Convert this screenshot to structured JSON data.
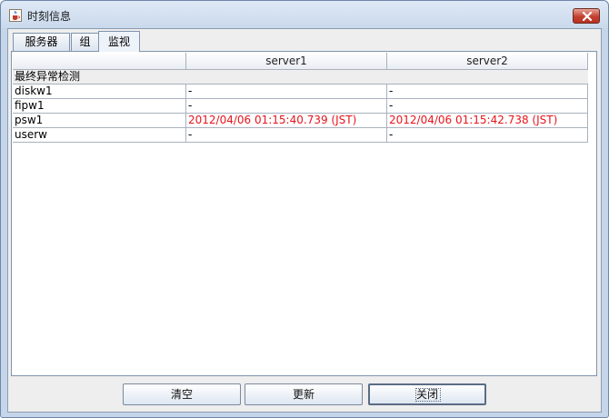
{
  "window": {
    "title": "时刻信息",
    "icon": "java-cup-icon",
    "close_icon": "close-x-icon"
  },
  "tabs": [
    {
      "label": "服务器",
      "active": false
    },
    {
      "label": "组",
      "active": false
    },
    {
      "label": "监视",
      "active": true
    }
  ],
  "table": {
    "headers": [
      "",
      "server1",
      "server2"
    ],
    "group_label": "最终异常检测",
    "rows": [
      {
        "name": "diskw1",
        "server1": "-",
        "server2": "-"
      },
      {
        "name": "fipw1",
        "server1": "-",
        "server2": "-"
      },
      {
        "name": "psw1",
        "server1": "2012/04/06 01:15:40.739 (JST)",
        "server2": "2012/04/06 01:15:42.738 (JST)"
      },
      {
        "name": "userw",
        "server1": "-",
        "server2": "-"
      }
    ],
    "highlight_color": "#e8141c"
  },
  "buttons": {
    "clear": "清空",
    "refresh": "更新",
    "close": "关闭"
  }
}
